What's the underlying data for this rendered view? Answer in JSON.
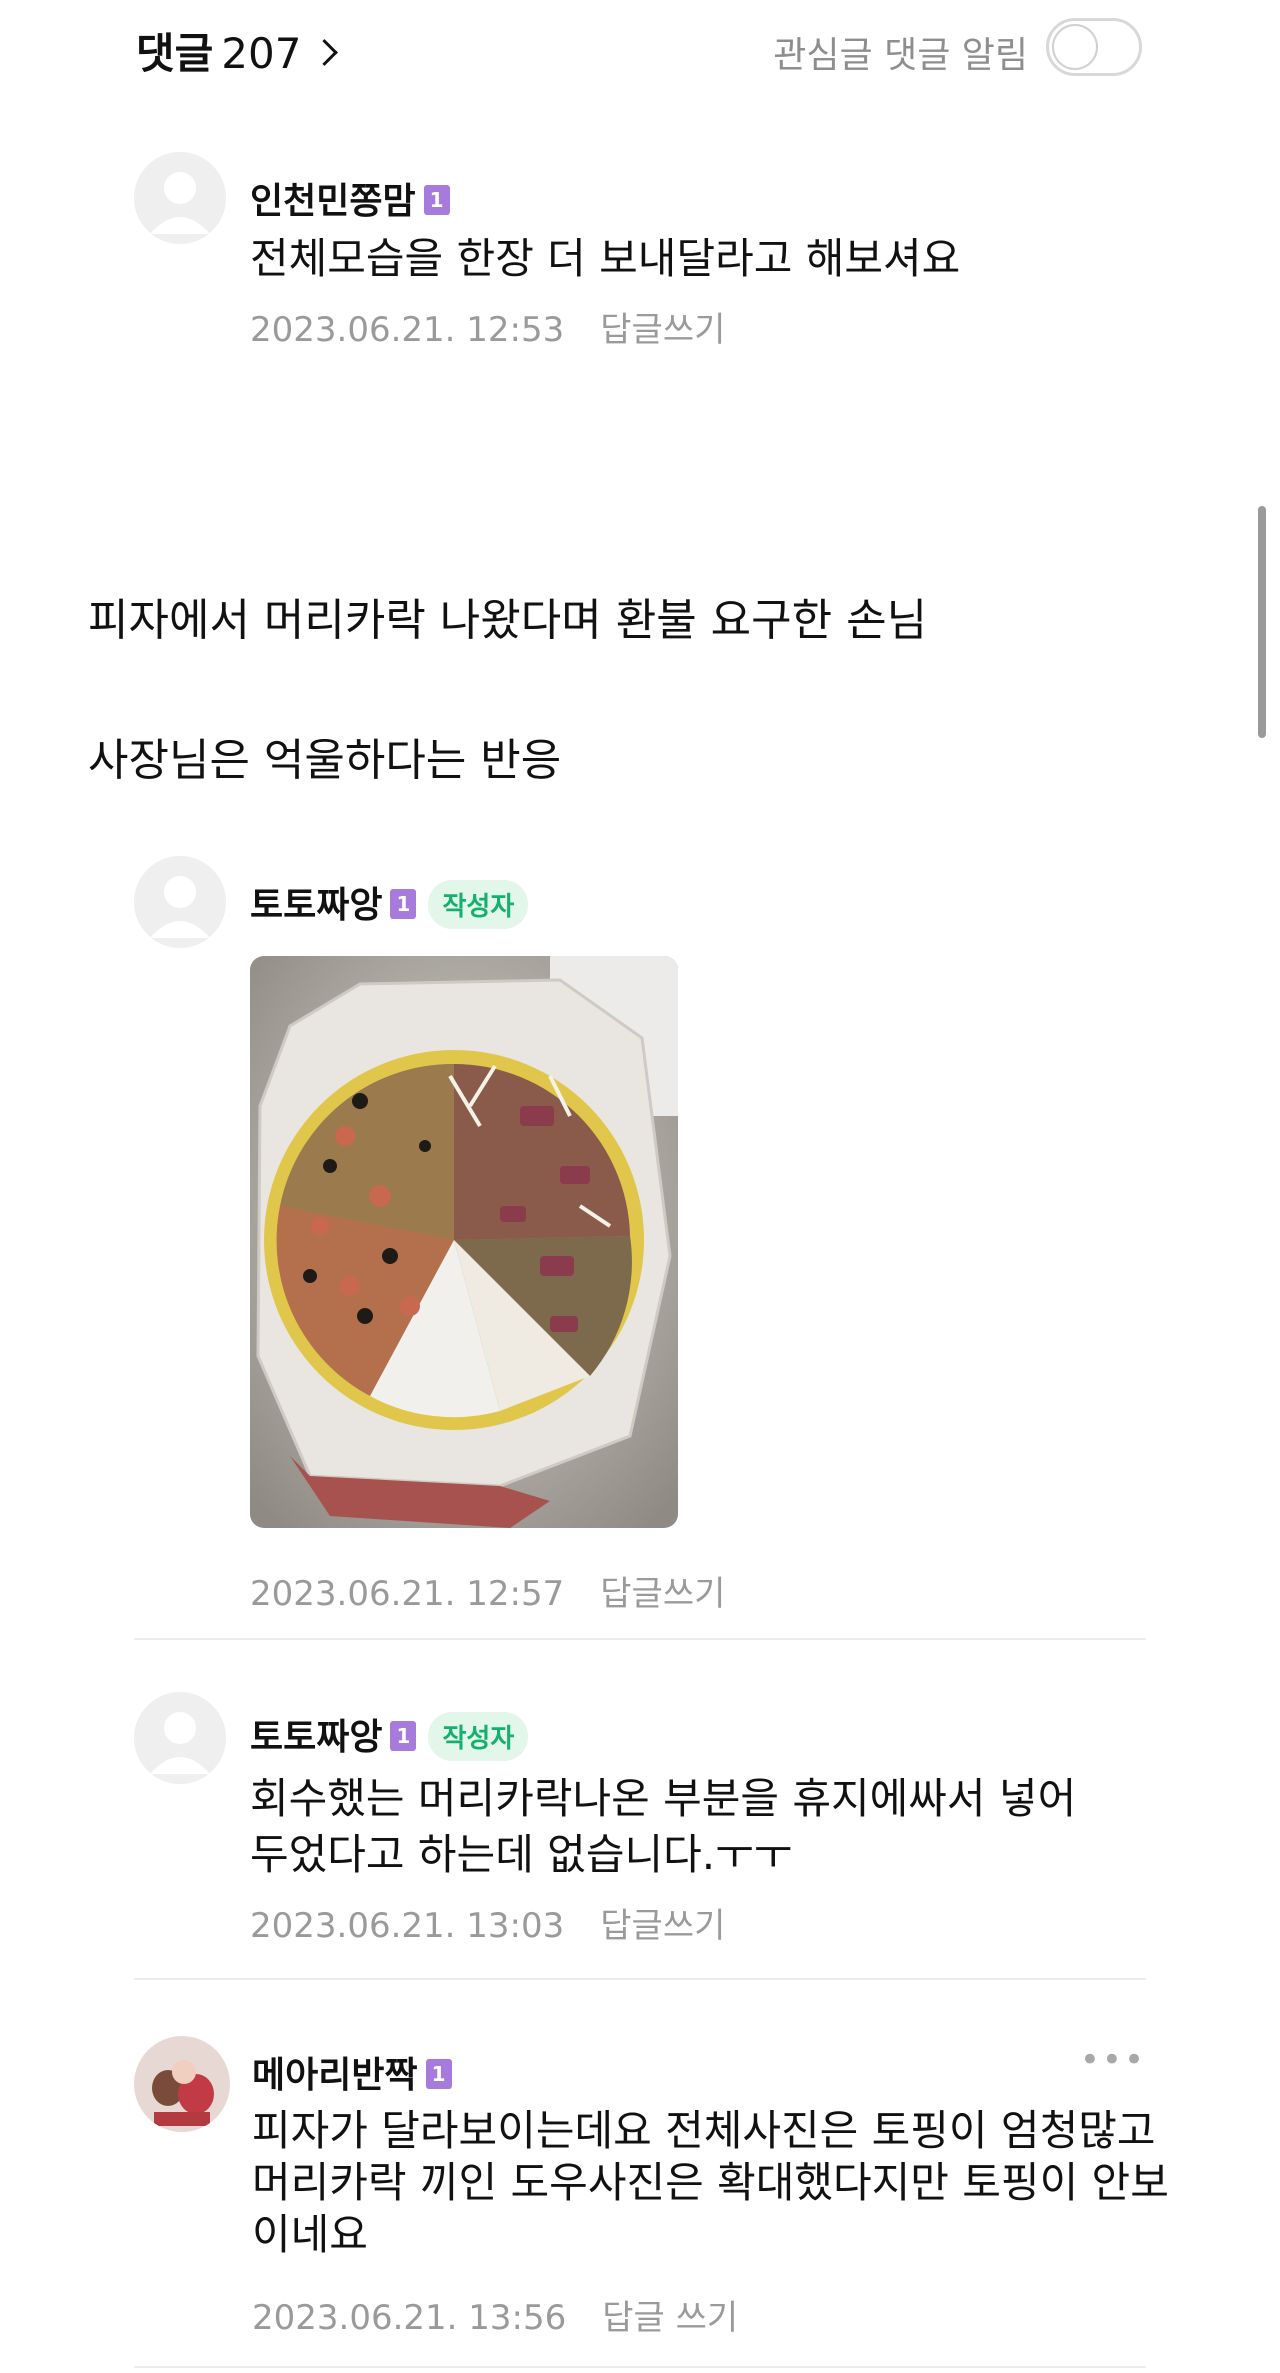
{
  "header": {
    "comments_label": "댓글",
    "comments_count": "207",
    "alert_label": "관심글 댓글 알림",
    "alert_toggle_on": false
  },
  "comments": [
    {
      "nickname": "인천민쫑맘",
      "level": "1",
      "text_lines": [
        "전체모습을 한장 더 보내달라고 해보셔요"
      ],
      "date": "2023.06.21. 12:53",
      "reply": "답글쓰기"
    },
    {
      "nickname": "토토짜앙",
      "level": "1",
      "badge": "작성자",
      "image": "pizza-photo",
      "date": "2023.06.21. 12:57",
      "reply": "답글쓰기"
    },
    {
      "nickname": "토토짜앙",
      "level": "1",
      "badge": "작성자",
      "text_lines": [
        "회수했는 머리카락나온 부분을 휴지에싸서 넣어",
        "두었다고 하는데 없습니다.ㅜㅜ"
      ],
      "date": "2023.06.21. 13:03",
      "reply": "답글쓰기"
    },
    {
      "nickname": "메아리반짝",
      "level": "1",
      "text_lines": [
        "피자가 달라보이는데요 전체사진은 토핑이 엄청많고",
        "머리카락 끼인 도우사진은 확대했다지만 토핑이 안보",
        "이네요"
      ],
      "date": "2023.06.21. 13:56",
      "reply": "답글 쓰기",
      "more": "•••"
    }
  ],
  "post": {
    "lines": [
      "피자에서 머리카락 나왔다며 환불 요구한 손님",
      "사장님은 억울하다는 반응"
    ]
  },
  "colors": {
    "level_badge": "#a77bdb",
    "author_badge_bg": "#e3f6ea",
    "author_badge_text": "#16b06e",
    "meta_text": "#9a9a9a"
  }
}
